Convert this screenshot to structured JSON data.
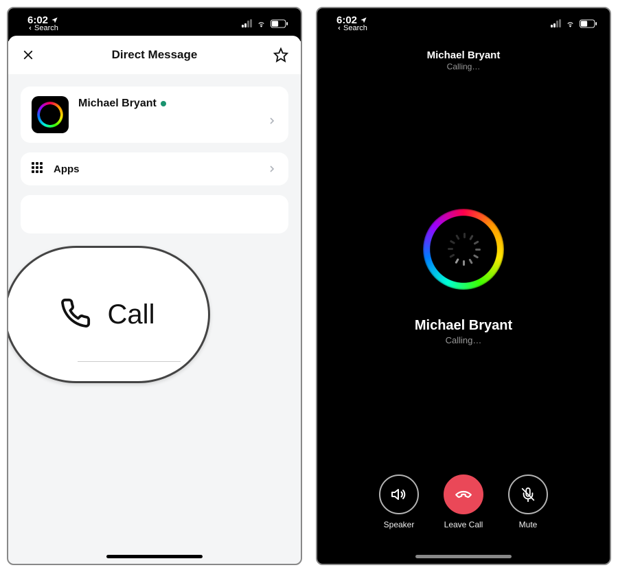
{
  "status_bar": {
    "time": "6:02",
    "back_label": "Search"
  },
  "left": {
    "header_title": "Direct Message",
    "profile": {
      "name": "Michael Bryant"
    },
    "apps_label": "Apps",
    "zoom": {
      "call_label": "Call"
    }
  },
  "right": {
    "top_name": "Michael Bryant",
    "top_status": "Calling…",
    "center_name": "Michael Bryant",
    "center_status": "Calling…",
    "buttons": {
      "speaker": "Speaker",
      "leave": "Leave Call",
      "mute": "Mute"
    }
  }
}
